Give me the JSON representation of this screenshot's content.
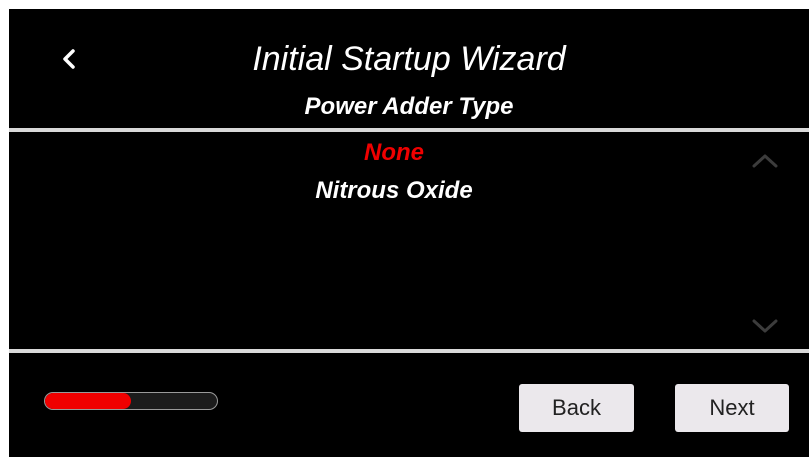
{
  "header": {
    "title": "Initial Startup Wizard",
    "subtitle": "Power Adder Type"
  },
  "options": [
    {
      "label": "None",
      "selected": true
    },
    {
      "label": "Nitrous Oxide",
      "selected": false
    }
  ],
  "colors": {
    "selected": "#f00000",
    "text": "#ffffff",
    "background": "#000000",
    "button": "#ebe8ec"
  },
  "progress": {
    "fraction": 0.5
  },
  "footer": {
    "back_label": "Back",
    "next_label": "Next"
  },
  "icons": {
    "back": "chevron-left-icon",
    "scroll_up": "chevron-up-icon",
    "scroll_down": "chevron-down-icon"
  }
}
